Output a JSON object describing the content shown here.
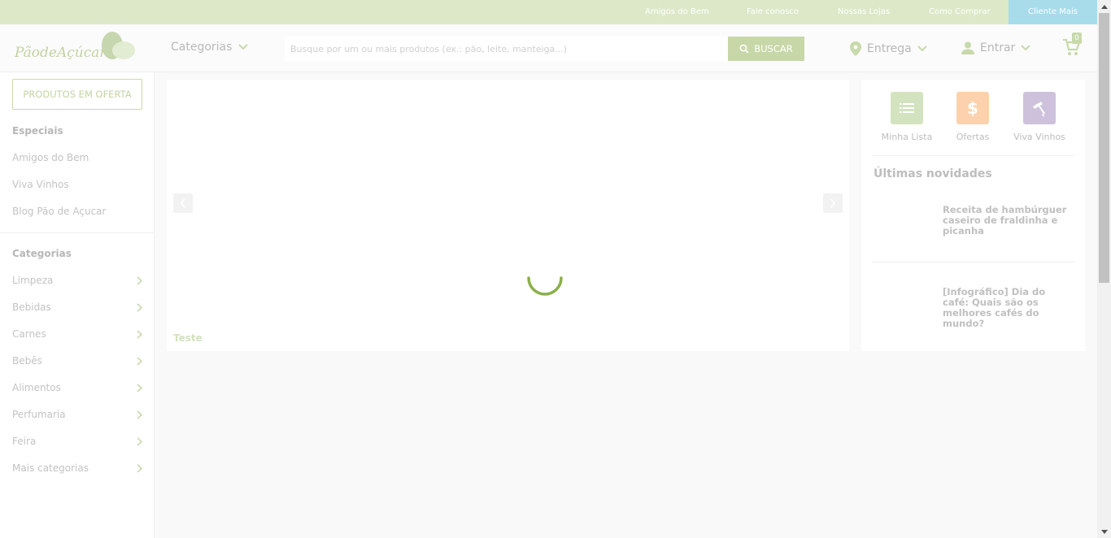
{
  "topbar": {
    "links": [
      "Amigos do Bem",
      "Fale conosco",
      "Nossas Lojas",
      "Como Comprar"
    ],
    "cliente_mais": "Cliente Mais"
  },
  "header": {
    "logo_text": "PãodeAçúcar",
    "categorias_label": "Categorias",
    "search_placeholder": "Busque por um ou mais produtos (ex.: pão, leite, manteiga...)",
    "buscar_label": "BUSCAR",
    "entrega_label": "Entrega",
    "entrar_label": "Entrar",
    "cart_count": "0"
  },
  "sidebar": {
    "oferta_button": "PRODUTOS EM OFERTA",
    "especiais_heading": "Especiais",
    "especiais": [
      "Amigos do Bem",
      "Viva Vinhos",
      "Blog Pão de Açucar"
    ],
    "categorias_heading": "Categorias",
    "categorias": [
      "Limpeza",
      "Bebidas",
      "Carnes",
      "Bebês",
      "Alimentos",
      "Perfumaria",
      "Feira",
      "Mais categorias"
    ]
  },
  "banner": {
    "caption": "Teste"
  },
  "right_panel": {
    "quick_links": [
      {
        "label": "Minha Lista",
        "icon": "list-icon",
        "color": "#d3e3bf"
      },
      {
        "label": "Ofertas",
        "icon": "dollar-icon",
        "color": "#fbd2ac"
      },
      {
        "label": "Viva Vinhos",
        "icon": "corkscrew-icon",
        "color": "#cdc1dc"
      }
    ],
    "ultimas_heading": "Últimas novidades",
    "news": [
      "Receita de hambúrguer caseiro de fraldinha e picanha",
      "[Infográfico] Dia do café: Quais são os melhores cafés do mundo?"
    ]
  },
  "colors": {
    "accent_green": "#c7d7a7",
    "topbar": "#dde8c8",
    "cliente_mais_bg": "#a8dceb",
    "spinner": "#8ab04a"
  }
}
